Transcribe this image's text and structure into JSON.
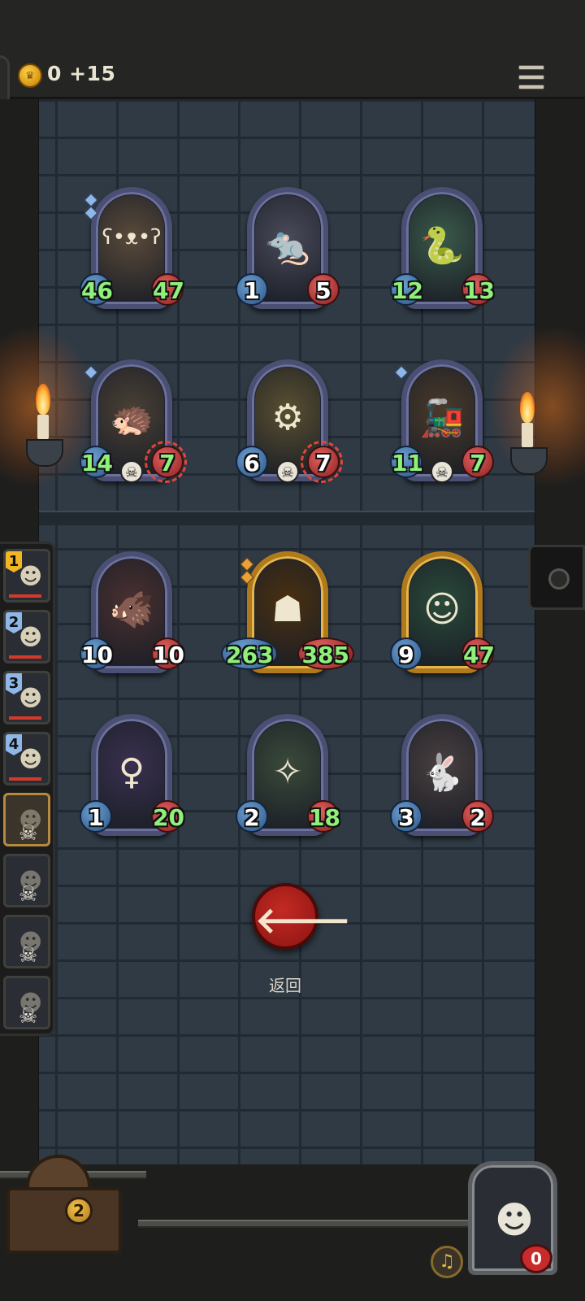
{
  "header": {
    "gold_text": "0 +15",
    "coin_icon": "crown-coin-icon",
    "menu_icon": "hamburger-menu-icon"
  },
  "colors": {
    "wall": "#2f3a44",
    "attack_badge": "#2c5688",
    "health_badge": "#902121",
    "buffed_stat": "#8ff07a",
    "back_button": "#c42a24",
    "gold_frame": "#b07a1c",
    "frame": "#4a4f73"
  },
  "opponent_board": [
    {
      "name": "bandit-bear",
      "icon": "bear-icon",
      "attack": "46",
      "health": "47",
      "stars": 2,
      "skull": false,
      "gold": false,
      "buffed": true
    },
    {
      "name": "rat-pirate",
      "icon": "rat-icon",
      "attack": "1",
      "health": "5",
      "stars": 0,
      "skull": false,
      "gold": false,
      "buffed": false
    },
    {
      "name": "crowned-snake",
      "icon": "snake-icon",
      "attack": "12",
      "health": "13",
      "stars": 0,
      "skull": false,
      "gold": false,
      "buffed": true
    },
    {
      "name": "hedgehog-thief",
      "icon": "hedgehog-icon",
      "attack": "14",
      "health": "7",
      "stars": 1,
      "skull": true,
      "gold": false,
      "buffed": true
    },
    {
      "name": "cheese-robot",
      "icon": "robot-icon",
      "attack": "6",
      "health": "7",
      "stars": 0,
      "skull": true,
      "gold": false,
      "buffed": false
    },
    {
      "name": "steam-train",
      "icon": "train-icon",
      "attack": "11",
      "health": "7",
      "stars": 1,
      "skull": true,
      "gold": false,
      "buffed": true
    }
  ],
  "player_board": [
    {
      "name": "wild-boar",
      "icon": "boar-icon",
      "attack": "10",
      "health": "10",
      "stars": 0,
      "gold": false,
      "style": "white"
    },
    {
      "name": "tiki-totem",
      "icon": "totem-icon",
      "attack": "263",
      "health": "385",
      "stars": 2,
      "gold": true,
      "style": "green"
    },
    {
      "name": "grinning-imp",
      "icon": "imp-icon",
      "attack": "9",
      "health": "47",
      "stars": 0,
      "gold": true,
      "style": "mixed"
    },
    {
      "name": "sea-witch",
      "icon": "witch-icon",
      "attack": "1",
      "health": "20",
      "stars": 0,
      "gold": false,
      "style": "mixed"
    },
    {
      "name": "fairy",
      "icon": "fairy-icon",
      "attack": "2",
      "health": "18",
      "stars": 0,
      "gold": false,
      "style": "mixed"
    },
    {
      "name": "masked-rabbit",
      "icon": "rabbit-icon",
      "attack": "3",
      "health": "2",
      "stars": 0,
      "gold": false,
      "style": "white"
    }
  ],
  "roster": [
    {
      "rank": "1",
      "icon": "hero-portrait-1-icon",
      "eliminated": false,
      "active": false
    },
    {
      "rank": "2",
      "icon": "hero-portrait-2-icon",
      "eliminated": false,
      "active": false
    },
    {
      "rank": "3",
      "icon": "hero-portrait-3-icon",
      "eliminated": false,
      "active": false
    },
    {
      "rank": "4",
      "icon": "hero-portrait-4-icon",
      "eliminated": false,
      "active": false
    },
    {
      "rank": "",
      "icon": "skull-icon",
      "eliminated": true,
      "active": true
    },
    {
      "rank": "",
      "icon": "skull-icon",
      "eliminated": true,
      "active": false
    },
    {
      "rank": "",
      "icon": "skull-icon",
      "eliminated": true,
      "active": false
    },
    {
      "rank": "",
      "icon": "skull-icon",
      "eliminated": true,
      "active": false
    }
  ],
  "back_button": {
    "label": "返回",
    "icon": "back-arrow-icon"
  },
  "footer": {
    "chest_count": "2",
    "hero_health": "0",
    "bell_icon": "bell-icon"
  }
}
